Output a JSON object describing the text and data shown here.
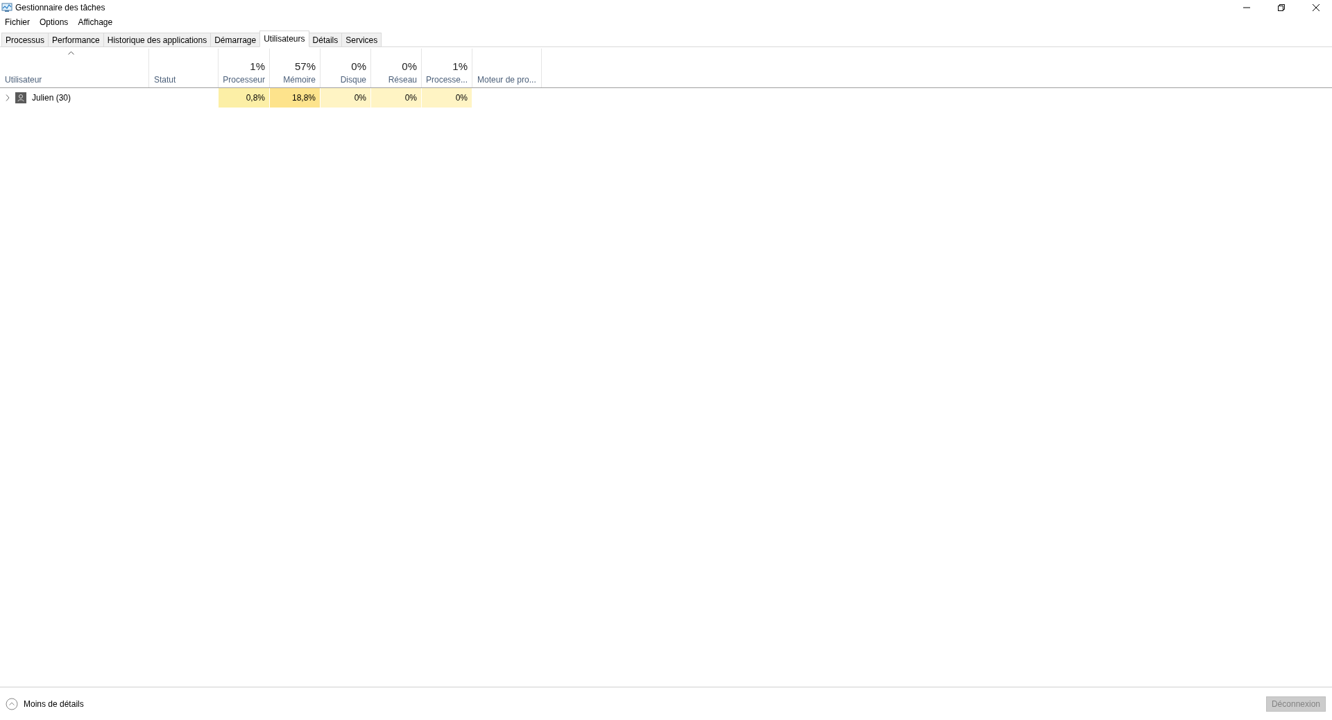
{
  "window": {
    "title": "Gestionnaire des tâches"
  },
  "menu": [
    "Fichier",
    "Options",
    "Affichage"
  ],
  "tabs": [
    {
      "label": "Processus",
      "selected": false
    },
    {
      "label": "Performance",
      "selected": false
    },
    {
      "label": "Historique des applications",
      "selected": false
    },
    {
      "label": "Démarrage",
      "selected": false
    },
    {
      "label": "Utilisateurs",
      "selected": true
    },
    {
      "label": "Détails",
      "selected": false
    },
    {
      "label": "Services",
      "selected": false
    }
  ],
  "table": {
    "columns": [
      {
        "label": "Utilisateur",
        "sorted": true
      },
      {
        "label": "Statut",
        "sorted": false
      },
      {
        "label": "Processeur",
        "total": "1%",
        "sorted": false
      },
      {
        "label": "Mémoire",
        "total": "57%",
        "sorted": false
      },
      {
        "label": "Disque",
        "total": "0%",
        "sorted": false
      },
      {
        "label": "Réseau",
        "total": "0%",
        "sorted": false
      },
      {
        "label": "Processe...",
        "total": "1%",
        "sorted": false
      },
      {
        "label": "Moteur de pro...",
        "sorted": false
      }
    ],
    "rows": [
      {
        "expanded": false,
        "cells": [
          {
            "value": "Julien (30)"
          },
          {},
          {
            "value": "0,8%",
            "color": "#fcefa6"
          },
          {
            "value": "18,8%",
            "color": "#fde38c"
          },
          {
            "value": "0%",
            "color": "#fff4c4"
          },
          {
            "value": "0%",
            "color": "#fff4c4"
          },
          {
            "value": "0%",
            "color": "#fff4c4"
          },
          {}
        ]
      }
    ]
  },
  "footer": {
    "details_link": "Moins de détails",
    "disconnect": {
      "label": "Déconnexion",
      "disabled": true
    }
  }
}
